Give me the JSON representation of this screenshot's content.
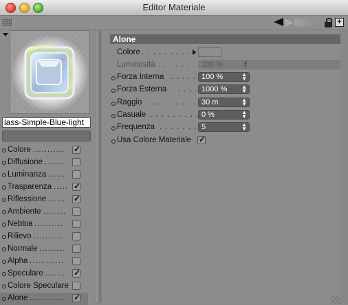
{
  "window": {
    "title": "Editor Materiale"
  },
  "material": {
    "name": "lass-Simple-Blue-light"
  },
  "channels": [
    {
      "label": "Colore",
      "checked": true
    },
    {
      "label": "Diffusione",
      "checked": false
    },
    {
      "label": "Luminanza",
      "checked": false
    },
    {
      "label": "Trasparenza",
      "checked": true
    },
    {
      "label": "Riflessione",
      "checked": true
    },
    {
      "label": "Ambiente",
      "checked": false
    },
    {
      "label": "Nebbia",
      "checked": false
    },
    {
      "label": "Rilievo",
      "checked": false
    },
    {
      "label": "Normale",
      "checked": false
    },
    {
      "label": "Alpha",
      "checked": false
    },
    {
      "label": "Speculare",
      "checked": true
    },
    {
      "label": "Colore Speculare",
      "checked": false
    },
    {
      "label": "Alone",
      "checked": true,
      "selected": true
    }
  ],
  "section": {
    "title": "Alone"
  },
  "props": {
    "colore": {
      "label": "Colore"
    },
    "luminosita": {
      "label": "Luminosità",
      "value": "100 %"
    },
    "forza_interna": {
      "label": "Forza Interna",
      "value": "100 %"
    },
    "forza_esterna": {
      "label": "Forza Esterna",
      "value": "1000 %"
    },
    "raggio": {
      "label": "Raggio",
      "value": "30 m"
    },
    "casuale": {
      "label": "Casuale",
      "value": "0 %"
    },
    "frequenza": {
      "label": "Frequenza",
      "value": "5"
    },
    "usa_colore": {
      "label": "Usa Colore Materiale",
      "checked": true
    }
  },
  "icons": [
    "lock-icon",
    "new-window-icon",
    "back-arrow-icon",
    "forward-arrow-icon",
    "menu-triangle-icon"
  ]
}
